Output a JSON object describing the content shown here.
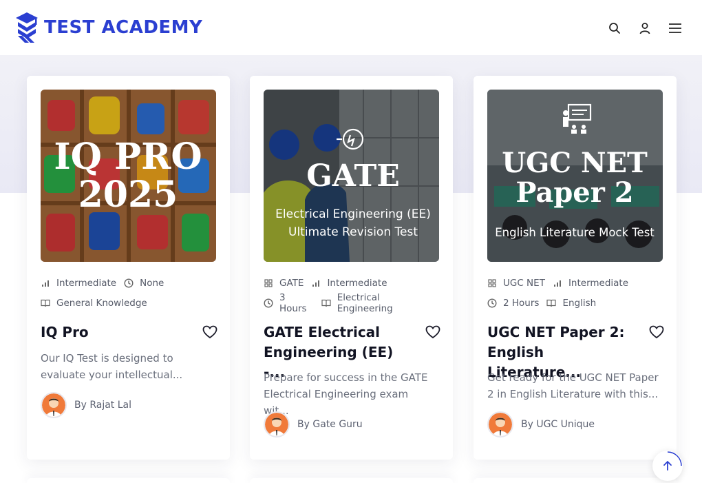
{
  "header": {
    "logo_text": "TEST ACADEMY",
    "icons": [
      "search-icon",
      "user-icon",
      "menu-icon"
    ]
  },
  "colors": {
    "brand": "#2b3fd1",
    "band": "#ebebf5"
  },
  "cards": [
    {
      "thumb": {
        "line1": "IQ PRO",
        "line2": "2025"
      },
      "meta_rows": [
        [
          {
            "icon": "level-icon",
            "text": "Intermediate"
          },
          {
            "icon": "clock-icon",
            "text": "None"
          }
        ],
        [
          {
            "icon": "book-icon",
            "text": "General Knowledge"
          }
        ]
      ],
      "title_lines": [
        "IQ Pro"
      ],
      "desc_lines": [
        "Our IQ Test is designed to",
        "evaluate your intellectual..."
      ],
      "author": "By Rajat Lal"
    },
    {
      "thumb": {
        "heading": "GATE",
        "sub1": "Electrical Engineering (EE)",
        "sub2": "Ultimate Revision Test"
      },
      "meta_rows": [
        [
          {
            "icon": "grid-icon",
            "text": "GATE"
          },
          {
            "icon": "level-icon",
            "text": "Intermediate"
          }
        ],
        [
          {
            "icon": "clock-icon",
            "text": "3 Hours"
          },
          {
            "icon": "book-icon",
            "text": "Electrical Engineering"
          }
        ]
      ],
      "title_lines": [
        "GATE Electrical",
        "Engineering (EE) -..."
      ],
      "desc_lines": [
        "Prepare for success in the GATE",
        "Electrical Engineering exam wit..."
      ],
      "author": "By Gate Guru"
    },
    {
      "thumb": {
        "heading1": "UGC NET",
        "heading2": "Paper 2",
        "sub": "English Literature Mock Test"
      },
      "meta_rows": [
        [
          {
            "icon": "grid-icon",
            "text": "UGC NET"
          },
          {
            "icon": "level-icon",
            "text": "Intermediate"
          }
        ],
        [
          {
            "icon": "clock-icon",
            "text": "2 Hours"
          },
          {
            "icon": "book-icon",
            "text": "English"
          }
        ]
      ],
      "title_lines": [
        "UGC NET Paper 2:",
        "English Literature..."
      ],
      "desc_lines": [
        "Get ready for the UGC NET Paper",
        "2 in English Literature with this..."
      ],
      "author": "By UGC Unique"
    }
  ]
}
